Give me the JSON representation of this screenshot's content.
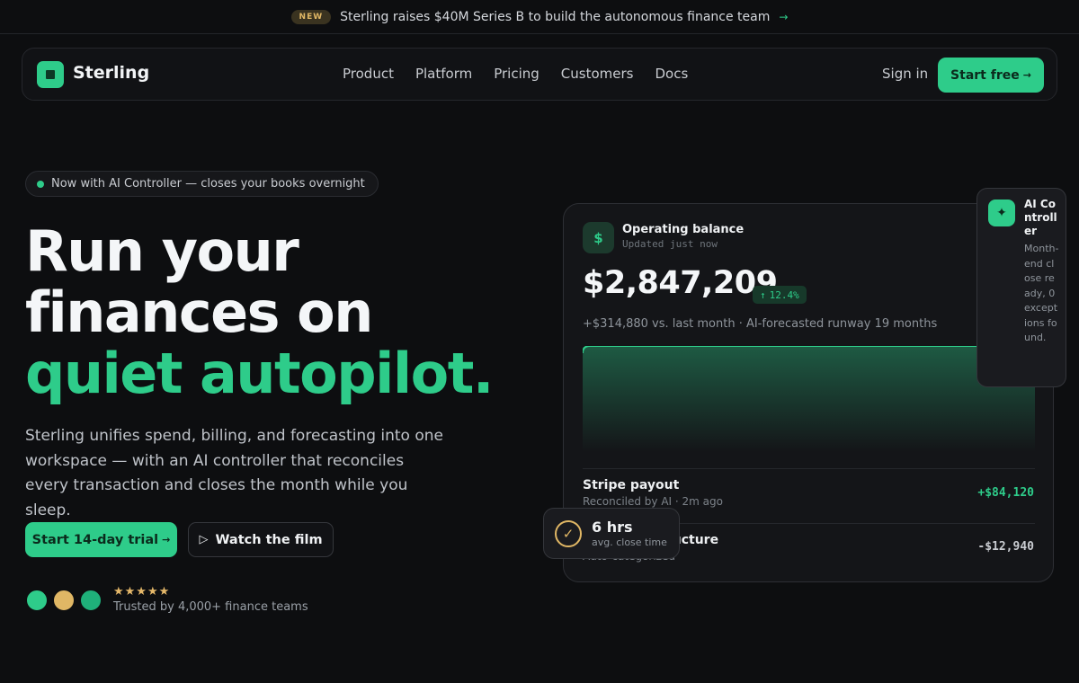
{
  "announcement": {
    "badge": "NEW",
    "text": "Sterling raises $40M Series B to build the autonomous finance team",
    "arrow": "→"
  },
  "nav": {
    "brand": "Sterling",
    "links": [
      "Product",
      "Platform",
      "Pricing",
      "Customers",
      "Docs"
    ],
    "signin": "Sign in",
    "cta": "Start free",
    "cta_arrow": "→"
  },
  "hero": {
    "pill": "Now with AI Controller — closes your books overnight",
    "headline_line1": "Run your finances on",
    "headline_line2": "quiet autopilot.",
    "lead": "Sterling unifies spend, billing, and forecasting into one workspace — with an AI controller that reconciles every transaction and closes the month while you sleep.",
    "cta_primary": "Start 14-day trial",
    "cta_primary_arrow": "→",
    "cta_secondary_icon": "▷",
    "cta_secondary": "Watch the film",
    "stars": "★★★★★",
    "trusted": "Trusted by 4,000+ finance teams",
    "avatar_colors": [
      "#2ecc8a",
      "#e0b765",
      "#1fb07a"
    ]
  },
  "dashboard": {
    "icon": "$",
    "title": "Operating balance",
    "updated": "Updated just now",
    "balance": "$2,847,209",
    "delta_arrow": "↑",
    "delta": "12.4%",
    "subtitle": "+$314,880 vs. last month · AI-forecasted runway 19 months",
    "transactions": [
      {
        "name": "Stripe payout",
        "meta": "Reconciled by AI · 2m ago",
        "amount": "+$84,120"
      },
      {
        "name": "AWS infrastructure",
        "meta": "Auto-categorized",
        "amount": "-$12,940"
      }
    ]
  },
  "ai_controller": {
    "icon": "✦",
    "title": "AI Controller",
    "text": "Month-end close ready, 0 exceptions found."
  },
  "close_time": {
    "icon": "✓",
    "value": "6 hrs",
    "label": "avg. close time"
  },
  "colors": {
    "accent": "#2ecc8a",
    "gold": "#e0b765",
    "background": "#0d0e10",
    "negative": "#c9ccd1"
  }
}
